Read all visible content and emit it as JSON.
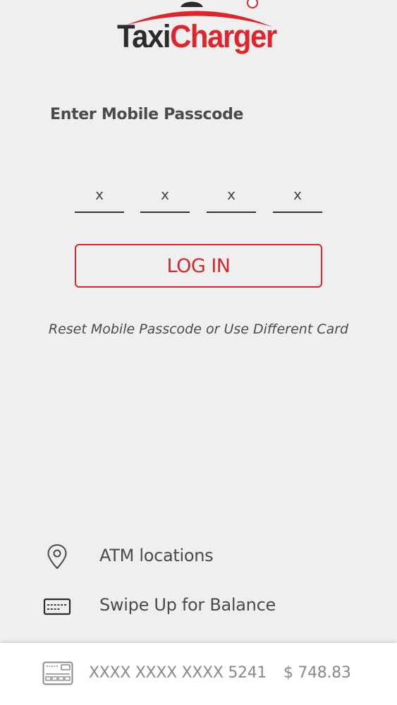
{
  "logo": {
    "part1": "Taxi",
    "part2": "Charger",
    "colors": {
      "taxi": "#2b2b2b",
      "charger": "#e0242b"
    }
  },
  "login": {
    "title": "Enter Mobile Passcode",
    "passcode_placeholders": [
      "x",
      "x",
      "x",
      "x"
    ],
    "button_label": "LOG IN",
    "reset_link": "Reset Mobile Passcode or Use Different Card"
  },
  "menu": {
    "atm": {
      "label": "ATM locations",
      "icon": "map-pin-icon"
    },
    "balance": {
      "label": "Swipe Up for Balance",
      "icon": "credit-card-icon"
    }
  },
  "card": {
    "icon": "card-chip-icon",
    "number": "XXXX XXXX XXXX 5241",
    "balance": "$ 748.83"
  },
  "colors": {
    "accent": "#e0242b",
    "background": "#efeff0",
    "text": "#4a4a4a",
    "muted_text": "#8a8a8a"
  }
}
